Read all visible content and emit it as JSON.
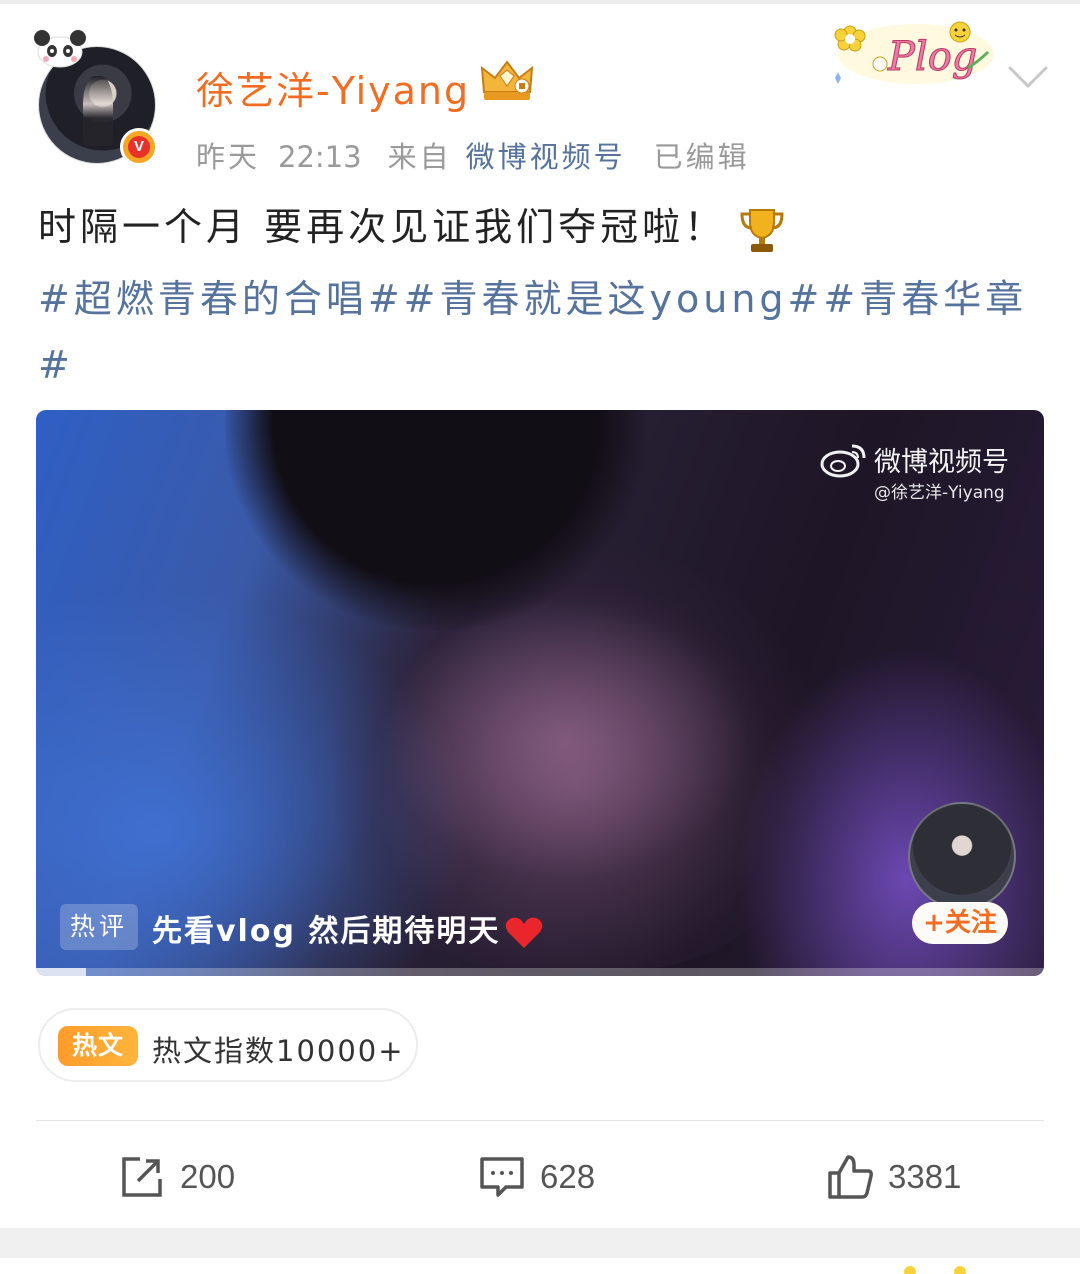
{
  "post": {
    "author": "徐艺洋-Yiyang",
    "meta": {
      "day": "昨天",
      "time": "22:13",
      "from": "来自",
      "source": "微博视频号",
      "edited": "已编辑"
    },
    "text": "时隔一个月 要再次见证我们夺冠啦！",
    "topics_line1": "#超燃青春的合唱##青春就是这young##青春华章",
    "topics_line2": "#",
    "verified_mark": "V"
  },
  "video": {
    "watermark_title": "微博视频号",
    "watermark_handle": "@徐艺洋-Yiyang",
    "hot_comment_label": "热评",
    "hot_comment_text": "先看vlog 然后期待明天",
    "follow_label": "+关注",
    "progress_fraction": 0.05
  },
  "hot_article": {
    "tag": "热文",
    "text": "热文指数10000+"
  },
  "actions": {
    "share_count": "200",
    "comment_count": "628",
    "like_count": "3381"
  },
  "colors": {
    "username": "#f26d21",
    "link": "#55739c",
    "hot_tag": "#ff9b2a"
  },
  "icons": [
    "panda-icon",
    "crown-badge-icon",
    "plog-sticker-icon",
    "chevron-down-icon",
    "trophy-icon",
    "weibo-logo-icon",
    "heart-icon",
    "share-icon",
    "comment-icon",
    "like-icon"
  ]
}
